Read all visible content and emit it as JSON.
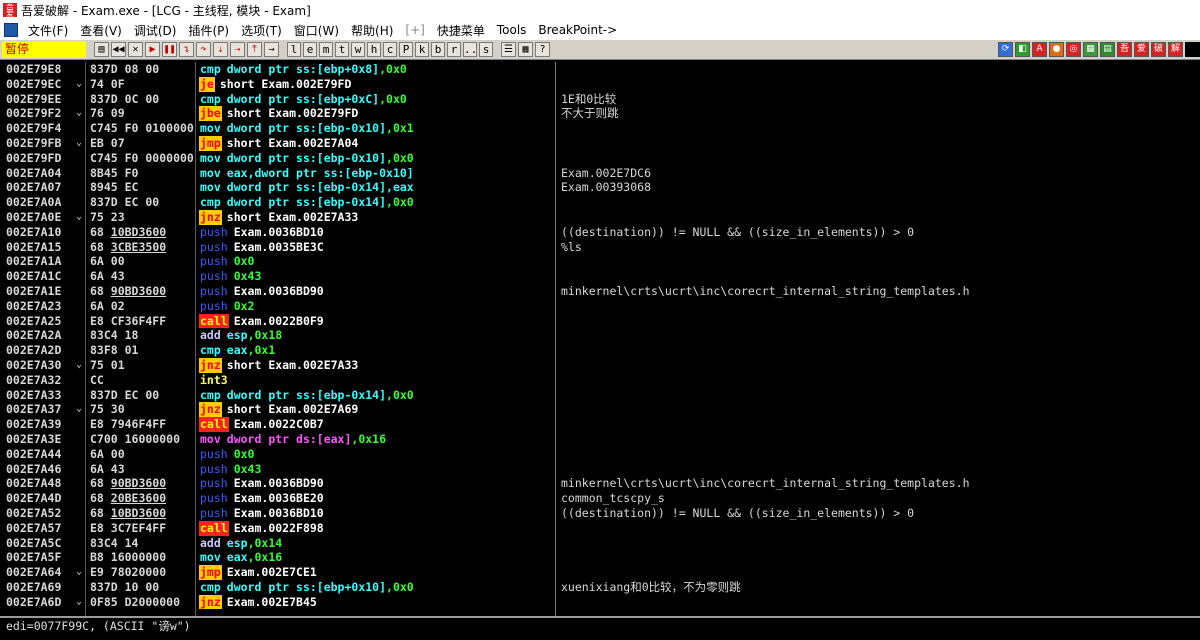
{
  "window": {
    "title": "吾爱破解 - Exam.exe - [LCG - 主线程, 模块 - Exam]",
    "app_icon_text": "吾爱"
  },
  "menu": [
    {
      "label": "文件(F)"
    },
    {
      "label": "查看(V)"
    },
    {
      "label": "调试(D)"
    },
    {
      "label": "插件(P)"
    },
    {
      "label": "选项(T)"
    },
    {
      "label": "窗口(W)"
    },
    {
      "label": "帮助(H)"
    },
    {
      "label": "[+]",
      "dim": true
    },
    {
      "label": "快捷菜单"
    },
    {
      "label": "Tools"
    },
    {
      "label": "BreakPoint->"
    }
  ],
  "toolbar": {
    "status": "暂停",
    "controls": [
      {
        "name": "open-icon",
        "glyph": "▤"
      },
      {
        "name": "restart-icon",
        "glyph": "◀◀"
      },
      {
        "name": "close-icon",
        "glyph": "✕"
      },
      {
        "name": "run-icon",
        "glyph": "▶"
      },
      {
        "name": "pause-icon",
        "glyph": "❚❚"
      },
      {
        "name": "step-into-icon",
        "glyph": "↴"
      },
      {
        "name": "step-over-icon",
        "glyph": "↷"
      },
      {
        "name": "trace-into-icon",
        "glyph": "⇣"
      },
      {
        "name": "trace-over-icon",
        "glyph": "⇢"
      },
      {
        "name": "execute-till-return-icon",
        "glyph": "⤒"
      },
      {
        "name": "goto-icon",
        "glyph": "→"
      }
    ],
    "letters": [
      "l",
      "e",
      "m",
      "t",
      "w",
      "h",
      "c",
      "P",
      "k",
      "b",
      "r",
      "...",
      "s"
    ],
    "extra": [
      {
        "name": "list-icon",
        "glyph": "☰"
      },
      {
        "name": "grid-icon",
        "glyph": "▦"
      },
      {
        "name": "help-icon",
        "glyph": "?"
      }
    ],
    "right_tools": [
      {
        "name": "refresh-icon",
        "glyph": "⟳",
        "color": "#2f6fd6"
      },
      {
        "name": "lock-icon",
        "glyph": "◧",
        "color": "#2e9e2e"
      },
      {
        "name": "a-icon",
        "glyph": "A",
        "color": "#d62222"
      },
      {
        "name": "record-icon",
        "glyph": "●",
        "color": "#e06a10"
      },
      {
        "name": "target-icon",
        "glyph": "◎",
        "color": "#d62222"
      },
      {
        "name": "calc-icon",
        "glyph": "▦",
        "color": "#3a9a3a"
      },
      {
        "name": "table-icon",
        "glyph": "▤",
        "color": "#2e8e2e"
      },
      {
        "name": "wu-icon",
        "glyph": "吾",
        "color": "#d62222"
      },
      {
        "name": "ai-icon",
        "glyph": "爱",
        "color": "#d62222"
      },
      {
        "name": "po-icon",
        "glyph": "破",
        "color": "#d62222"
      },
      {
        "name": "jie-icon",
        "glyph": "解",
        "color": "#d62222"
      },
      {
        "name": "black-icon",
        "glyph": "",
        "color": "#000000"
      }
    ]
  },
  "rows": [
    {
      "addr": "002E79E8",
      "hex": "837D 08 00",
      "mn": "cmp",
      "cls": "m-cmp",
      "ops": [
        [
          "dword ptr ss:[ebp+0x8]",
          "o-cyan"
        ],
        [
          ",0x0",
          "o-green"
        ]
      ],
      "comment": ""
    },
    {
      "addr": "002E79EC",
      "arrow": true,
      "hex": "74 0F",
      "mn": "je",
      "cls": "m-jcc",
      "ops": [
        [
          "short Exam.002E79FD",
          "o-white"
        ]
      ],
      "comment": ""
    },
    {
      "addr": "002E79EE",
      "hex": "837D 0C 00",
      "mn": "cmp",
      "cls": "m-cmp",
      "ops": [
        [
          "dword ptr ss:[ebp+0xC]",
          "o-cyan"
        ],
        [
          ",0x0",
          "o-green"
        ]
      ],
      "comment": "1E和0比较"
    },
    {
      "addr": "002E79F2",
      "arrow": true,
      "hex": "76 09",
      "mn": "jbe",
      "cls": "m-jcc",
      "ops": [
        [
          "short Exam.002E79FD",
          "o-white"
        ]
      ],
      "comment": "不大于则跳"
    },
    {
      "addr": "002E79F4",
      "hex": "C745 F0 0100000",
      "mn": "mov",
      "cls": "m-mov",
      "ops": [
        [
          "dword ptr ss:[ebp-0x10]",
          "o-cyan"
        ],
        [
          ",0x1",
          "o-green"
        ]
      ],
      "comment": ""
    },
    {
      "addr": "002E79FB",
      "arrow": true,
      "hex": "EB 07",
      "mn": "jmp",
      "cls": "m-jmp",
      "ops": [
        [
          "short Exam.002E7A04",
          "o-white"
        ]
      ],
      "comment": ""
    },
    {
      "addr": "002E79FD",
      "hex": "C745 F0 0000000",
      "mn": "mov",
      "cls": "m-mov",
      "ops": [
        [
          "dword ptr ss:[ebp-0x10]",
          "o-cyan"
        ],
        [
          ",0x0",
          "o-green"
        ]
      ],
      "comment": ""
    },
    {
      "addr": "002E7A04",
      "hex": "8B45 F0",
      "mn": "mov",
      "cls": "m-mov",
      "ops": [
        [
          "eax,dword ptr ss:[ebp-0x10]",
          "o-cyan"
        ]
      ],
      "comment": "Exam.002E7DC6"
    },
    {
      "addr": "002E7A07",
      "hex": "8945 EC",
      "mn": "mov",
      "cls": "m-mov",
      "ops": [
        [
          "dword ptr ss:[ebp-0x14],eax",
          "o-cyan"
        ]
      ],
      "comment": "Exam.00393068"
    },
    {
      "addr": "002E7A0A",
      "hex": "837D EC 00",
      "mn": "cmp",
      "cls": "m-cmp",
      "ops": [
        [
          "dword ptr ss:[ebp-0x14]",
          "o-cyan"
        ],
        [
          ",0x0",
          "o-green"
        ]
      ],
      "comment": ""
    },
    {
      "addr": "002E7A0E",
      "arrow": true,
      "hex": "75 23",
      "mn": "jnz",
      "cls": "m-jcc",
      "ops": [
        [
          "short Exam.002E7A33",
          "o-white"
        ]
      ],
      "comment": ""
    },
    {
      "addr": "002E7A10",
      "hex": "68 ",
      "hexu": "10BD3600",
      "mn": "push",
      "cls": "m-push",
      "ops": [
        [
          "Exam.0036BD10",
          "o-white"
        ]
      ],
      "comment": "((destination)) != NULL && ((size_in_elements)) > 0"
    },
    {
      "addr": "002E7A15",
      "hex": "68 ",
      "hexu": "3CBE3500",
      "mn": "push",
      "cls": "m-push",
      "ops": [
        [
          "Exam.0035BE3C",
          "o-white"
        ]
      ],
      "comment": "%ls"
    },
    {
      "addr": "002E7A1A",
      "hex": "6A 00",
      "mn": "push",
      "cls": "m-push",
      "ops": [
        [
          "0x0",
          "o-green"
        ]
      ],
      "comment": ""
    },
    {
      "addr": "002E7A1C",
      "hex": "6A 43",
      "mn": "push",
      "cls": "m-push",
      "ops": [
        [
          "0x43",
          "o-green"
        ]
      ],
      "comment": ""
    },
    {
      "addr": "002E7A1E",
      "hex": "68 ",
      "hexu": "90BD3600",
      "mn": "push",
      "cls": "m-push",
      "ops": [
        [
          "Exam.0036BD90",
          "o-white"
        ]
      ],
      "comment": "minkernel\\crts\\ucrt\\inc\\corecrt_internal_string_templates.h"
    },
    {
      "addr": "002E7A23",
      "hex": "6A 02",
      "mn": "push",
      "cls": "m-push",
      "ops": [
        [
          "0x2",
          "o-green"
        ]
      ],
      "comment": ""
    },
    {
      "addr": "002E7A25",
      "hex": "E8 CF36F4FF",
      "mn": "call",
      "cls": "m-call",
      "ops": [
        [
          "Exam.0022B0F9",
          "o-white"
        ]
      ],
      "comment": ""
    },
    {
      "addr": "002E7A2A",
      "hex": "83C4 18",
      "mn": "add",
      "cls": "m-add",
      "ops": [
        [
          "esp",
          "o-cyan"
        ],
        [
          ",0x18",
          "o-green"
        ]
      ],
      "comment": ""
    },
    {
      "addr": "002E7A2D",
      "hex": "83F8 01",
      "mn": "cmp",
      "cls": "m-cmp",
      "ops": [
        [
          "eax",
          "o-cyan"
        ],
        [
          ",0x1",
          "o-green"
        ]
      ],
      "comment": ""
    },
    {
      "addr": "002E7A30",
      "arrow": true,
      "hex": "75 01",
      "mn": "jnz",
      "cls": "m-jcc",
      "ops": [
        [
          "short Exam.002E7A33",
          "o-white"
        ]
      ],
      "comment": ""
    },
    {
      "addr": "002E7A32",
      "hex": "CC",
      "mn": "int3",
      "cls": "m-int3",
      "ops": [],
      "comment": ""
    },
    {
      "addr": "002E7A33",
      "hex": "837D EC 00",
      "mn": "cmp",
      "cls": "m-cmp",
      "ops": [
        [
          "dword ptr ss:[ebp-0x14]",
          "o-cyan"
        ],
        [
          ",0x0",
          "o-green"
        ]
      ],
      "comment": ""
    },
    {
      "addr": "002E7A37",
      "arrow": true,
      "hex": "75 30",
      "mn": "jnz",
      "cls": "m-jcc",
      "ops": [
        [
          "short Exam.002E7A69",
          "o-white"
        ]
      ],
      "comment": ""
    },
    {
      "addr": "002E7A39",
      "hex": "E8 7946F4FF",
      "mn": "call",
      "cls": "m-call",
      "ops": [
        [
          "Exam.0022C0B7",
          "o-white"
        ]
      ],
      "comment": ""
    },
    {
      "addr": "002E7A3E",
      "hex": "C700 16000000",
      "mn": "mov",
      "cls": "m-movds",
      "ops": [
        [
          "dword ptr ds:[eax]",
          "o-magenta"
        ],
        [
          ",0x16",
          "o-green"
        ]
      ],
      "comment": ""
    },
    {
      "addr": "002E7A44",
      "hex": "6A 00",
      "mn": "push",
      "cls": "m-push",
      "ops": [
        [
          "0x0",
          "o-green"
        ]
      ],
      "comment": ""
    },
    {
      "addr": "002E7A46",
      "hex": "6A 43",
      "mn": "push",
      "cls": "m-push",
      "ops": [
        [
          "0x43",
          "o-green"
        ]
      ],
      "comment": ""
    },
    {
      "addr": "002E7A48",
      "hex": "68 ",
      "hexu": "90BD3600",
      "mn": "push",
      "cls": "m-push",
      "ops": [
        [
          "Exam.0036BD90",
          "o-white"
        ]
      ],
      "comment": "minkernel\\crts\\ucrt\\inc\\corecrt_internal_string_templates.h"
    },
    {
      "addr": "002E7A4D",
      "hex": "68 ",
      "hexu": "20BE3600",
      "mn": "push",
      "cls": "m-push",
      "ops": [
        [
          "Exam.0036BE20",
          "o-white"
        ]
      ],
      "comment": "common_tcscpy_s"
    },
    {
      "addr": "002E7A52",
      "hex": "68 ",
      "hexu": "10BD3600",
      "mn": "push",
      "cls": "m-push",
      "ops": [
        [
          "Exam.0036BD10",
          "o-white"
        ]
      ],
      "comment": "((destination)) != NULL && ((size_in_elements)) > 0"
    },
    {
      "addr": "002E7A57",
      "hex": "E8 3C7EF4FF",
      "mn": "call",
      "cls": "m-call",
      "ops": [
        [
          "Exam.0022F898",
          "o-white"
        ]
      ],
      "comment": ""
    },
    {
      "addr": "002E7A5C",
      "hex": "83C4 14",
      "mn": "add",
      "cls": "m-add",
      "ops": [
        [
          "esp",
          "o-cyan"
        ],
        [
          ",0x14",
          "o-green"
        ]
      ],
      "comment": ""
    },
    {
      "addr": "002E7A5F",
      "hex": "B8 16000000",
      "mn": "mov",
      "cls": "m-mov",
      "ops": [
        [
          "eax",
          "o-cyan"
        ],
        [
          ",0x16",
          "o-green"
        ]
      ],
      "comment": ""
    },
    {
      "addr": "002E7A64",
      "arrow": true,
      "hex": "E9 78020000",
      "mn": "jmp",
      "cls": "m-jmp",
      "ops": [
        [
          "Exam.002E7CE1",
          "o-white"
        ]
      ],
      "comment": ""
    },
    {
      "addr": "002E7A69",
      "hex": "837D 10 00",
      "mn": "cmp",
      "cls": "m-cmp",
      "ops": [
        [
          "dword ptr ss:[ebp+0x10]",
          "o-cyan"
        ],
        [
          ",0x0",
          "o-green"
        ]
      ],
      "comment": "xuenixiang和0比较，不为零则跳"
    },
    {
      "addr": "002E7A6D",
      "arrow": true,
      "hex": "0F85 D2000000",
      "mn": "jnz",
      "cls": "m-jcc",
      "ops": [
        [
          "Exam.002E7B45",
          "o-white"
        ]
      ],
      "comment": ""
    }
  ],
  "info": "edi=0077F99C, (ASCII \"谤w\")"
}
